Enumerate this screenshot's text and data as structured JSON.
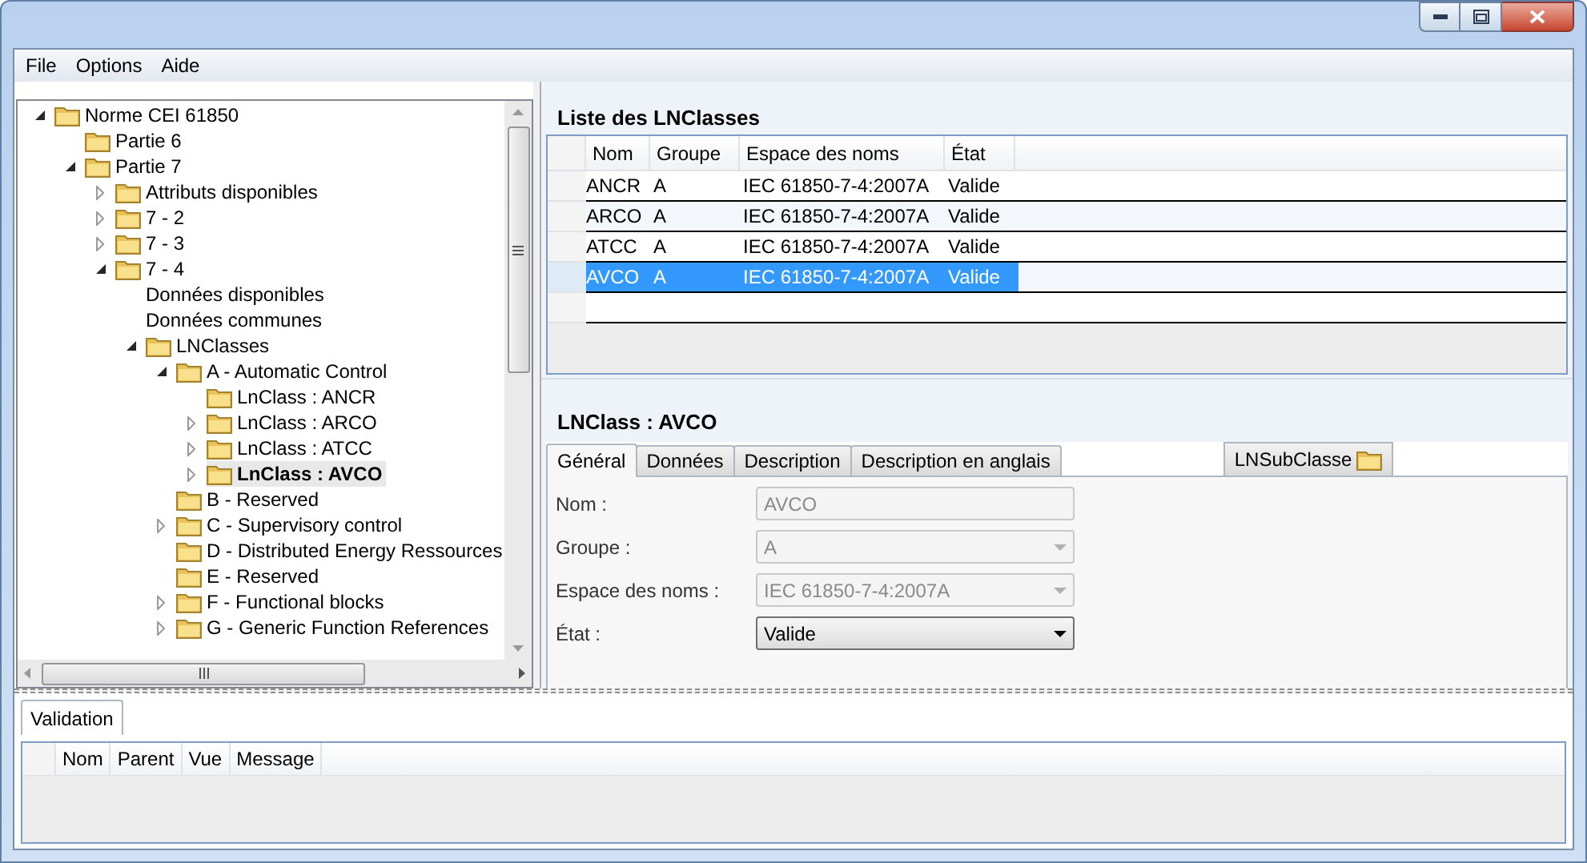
{
  "menu": [
    {
      "label": "File"
    },
    {
      "label": "Options"
    },
    {
      "label": "Aide"
    }
  ],
  "tree": {
    "items": [
      {
        "label": "Norme CEI 61850",
        "kind": "folder",
        "expanded": true,
        "selected": false,
        "children": [
          {
            "label": "Partie 6",
            "kind": "folder",
            "selected": false
          },
          {
            "label": "Partie 7",
            "kind": "folder",
            "expanded": true,
            "selected": false,
            "children": [
              {
                "label": "Attributs disponibles",
                "kind": "folder",
                "expanded": false,
                "selected": false
              },
              {
                "label": "7 - 2",
                "kind": "folder",
                "expanded": false,
                "selected": false
              },
              {
                "label": "7 - 3",
                "kind": "folder",
                "expanded": false,
                "selected": false
              },
              {
                "label": "7 - 4",
                "kind": "folder",
                "expanded": true,
                "selected": false,
                "children": [
                  {
                    "label": "Données disponibles",
                    "kind": "text",
                    "selected": false
                  },
                  {
                    "label": "Données communes",
                    "kind": "text",
                    "selected": false
                  },
                  {
                    "label": "LNClasses",
                    "kind": "folder",
                    "expanded": true,
                    "selected": false,
                    "children": [
                      {
                        "label": "A - Automatic Control",
                        "kind": "folder",
                        "expanded": true,
                        "selected": false,
                        "children": [
                          {
                            "label": "LnClass : ANCR",
                            "kind": "folder",
                            "selected": false
                          },
                          {
                            "label": "LnClass : ARCO",
                            "kind": "folder",
                            "expanded": false,
                            "selected": false
                          },
                          {
                            "label": "LnClass : ATCC",
                            "kind": "folder",
                            "expanded": false,
                            "selected": false
                          },
                          {
                            "label": "LnClass : AVCO",
                            "kind": "folder",
                            "expanded": false,
                            "selected": true
                          }
                        ]
                      },
                      {
                        "label": "B - Reserved",
                        "kind": "folder",
                        "selected": false
                      },
                      {
                        "label": "C - Supervisory control",
                        "kind": "folder",
                        "expanded": false,
                        "selected": false
                      },
                      {
                        "label": "D - Distributed Energy Ressources",
                        "kind": "folder",
                        "selected": false
                      },
                      {
                        "label": "E - Reserved",
                        "kind": "folder",
                        "selected": false
                      },
                      {
                        "label": "F - Functional blocks",
                        "kind": "folder",
                        "expanded": false,
                        "selected": false
                      },
                      {
                        "label": "G - Generic Function References",
                        "kind": "folder",
                        "expanded": false,
                        "selected": false
                      }
                    ]
                  }
                ]
              }
            ]
          }
        ]
      }
    ]
  },
  "lnclass_list": {
    "title": "Liste des LNClasses",
    "columns": [
      "Nom",
      "Groupe",
      "Espace des noms",
      "État"
    ],
    "rows": [
      {
        "cells": [
          "ANCR",
          "A",
          "IEC 61850-7-4:2007A",
          "Valide"
        ],
        "selected": false
      },
      {
        "cells": [
          "ARCO",
          "A",
          "IEC 61850-7-4:2007A",
          "Valide"
        ],
        "selected": false
      },
      {
        "cells": [
          "ATCC",
          "A",
          "IEC 61850-7-4:2007A",
          "Valide"
        ],
        "selected": false
      },
      {
        "cells": [
          "AVCO",
          "A",
          "IEC 61850-7-4:2007A",
          "Valide"
        ],
        "selected": true
      }
    ]
  },
  "detail": {
    "title": "LNClass : AVCO",
    "tabs": [
      {
        "label": "Général",
        "selected": true
      },
      {
        "label": "Données",
        "selected": false
      },
      {
        "label": "Description",
        "selected": false
      },
      {
        "label": "Description en anglais",
        "selected": false
      }
    ],
    "subclass_tab": {
      "label": "LNSubClasse"
    },
    "fields": [
      {
        "label": "Nom :",
        "value": "AVCO",
        "kind": "text",
        "disabled": true
      },
      {
        "label": "Groupe :",
        "value": "A",
        "kind": "select",
        "disabled": true
      },
      {
        "label": "Espace des noms :",
        "value": "IEC 61850-7-4:2007A",
        "kind": "select",
        "disabled": true
      },
      {
        "label": "État :",
        "value": "Valide",
        "kind": "select",
        "disabled": false
      }
    ]
  },
  "validation": {
    "tabs": [
      {
        "label": "Validation",
        "selected": true
      }
    ],
    "columns": [
      "Nom",
      "Parent",
      "Vue",
      "Message"
    ]
  }
}
